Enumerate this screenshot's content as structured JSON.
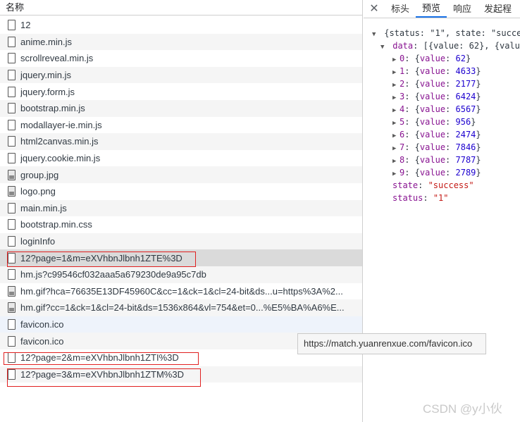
{
  "network": {
    "header": "名称",
    "requests": [
      {
        "name": "12",
        "icon": "file-icon"
      },
      {
        "name": "anime.min.js",
        "icon": "file-icon"
      },
      {
        "name": "scrollreveal.min.js",
        "icon": "file-icon"
      },
      {
        "name": "jquery.min.js",
        "icon": "file-icon"
      },
      {
        "name": "jquery.form.js",
        "icon": "file-icon"
      },
      {
        "name": "bootstrap.min.js",
        "icon": "file-icon"
      },
      {
        "name": "modallayer-ie.min.js",
        "icon": "file-icon"
      },
      {
        "name": "html2canvas.min.js",
        "icon": "file-icon"
      },
      {
        "name": "jquery.cookie.min.js",
        "icon": "file-icon"
      },
      {
        "name": "group.jpg",
        "icon": "image-file-icon"
      },
      {
        "name": "logo.png",
        "icon": "image-file-icon"
      },
      {
        "name": "main.min.js",
        "icon": "file-icon"
      },
      {
        "name": "bootstrap.min.css",
        "icon": "file-icon"
      },
      {
        "name": "loginInfo",
        "icon": "file-icon"
      },
      {
        "name": "12?page=1&m=eXVhbnJlbnh1ZTE%3D",
        "icon": "file-icon"
      },
      {
        "name": "hm.js?c99546cf032aaa5a679230de9a95c7db",
        "icon": "file-icon"
      },
      {
        "name": "hm.gif?hca=76635E13DF45960C&cc=1&ck=1&cl=24-bit&ds...u=https%3A%2...",
        "icon": "image-file-icon"
      },
      {
        "name": "hm.gif?cc=1&ck=1&cl=24-bit&ds=1536x864&vl=754&et=0...%E5%BA%A6%E...",
        "icon": "image-file-icon"
      },
      {
        "name": "favicon.ico",
        "icon": "file-icon"
      },
      {
        "name": "favicon.ico",
        "icon": "file-icon"
      },
      {
        "name": "12?page=2&m=eXVhbnJlbnh1ZTI%3D",
        "icon": "file-icon"
      },
      {
        "name": "12?page=3&m=eXVhbnJlbnh1ZTM%3D",
        "icon": "file-icon"
      }
    ]
  },
  "details": {
    "close": "✕",
    "tabs": [
      "标头",
      "预览",
      "响应",
      "发起程"
    ],
    "active_tab": "预览",
    "preview": {
      "summary": "{status: \"1\", state: \"succe",
      "data_summary": "[{value: 62}, {valu",
      "items": [
        {
          "index": "0",
          "value": "62"
        },
        {
          "index": "1",
          "value": "4633"
        },
        {
          "index": "2",
          "value": "2177"
        },
        {
          "index": "3",
          "value": "6424"
        },
        {
          "index": "4",
          "value": "6567"
        },
        {
          "index": "5",
          "value": "956"
        },
        {
          "index": "6",
          "value": "2474"
        },
        {
          "index": "7",
          "value": "7846"
        },
        {
          "index": "8",
          "value": "7787"
        },
        {
          "index": "9",
          "value": "2789"
        }
      ],
      "state_key": "state",
      "state_value": "\"success\"",
      "status_key": "status",
      "status_value": "\"1\""
    }
  },
  "tooltip": "https://match.yuanrenxue.com/favicon.ico",
  "watermark": "CSDN @y小伙",
  "colors": {
    "highlight_box": "#e02020",
    "active_tab": "#1a73e8"
  }
}
